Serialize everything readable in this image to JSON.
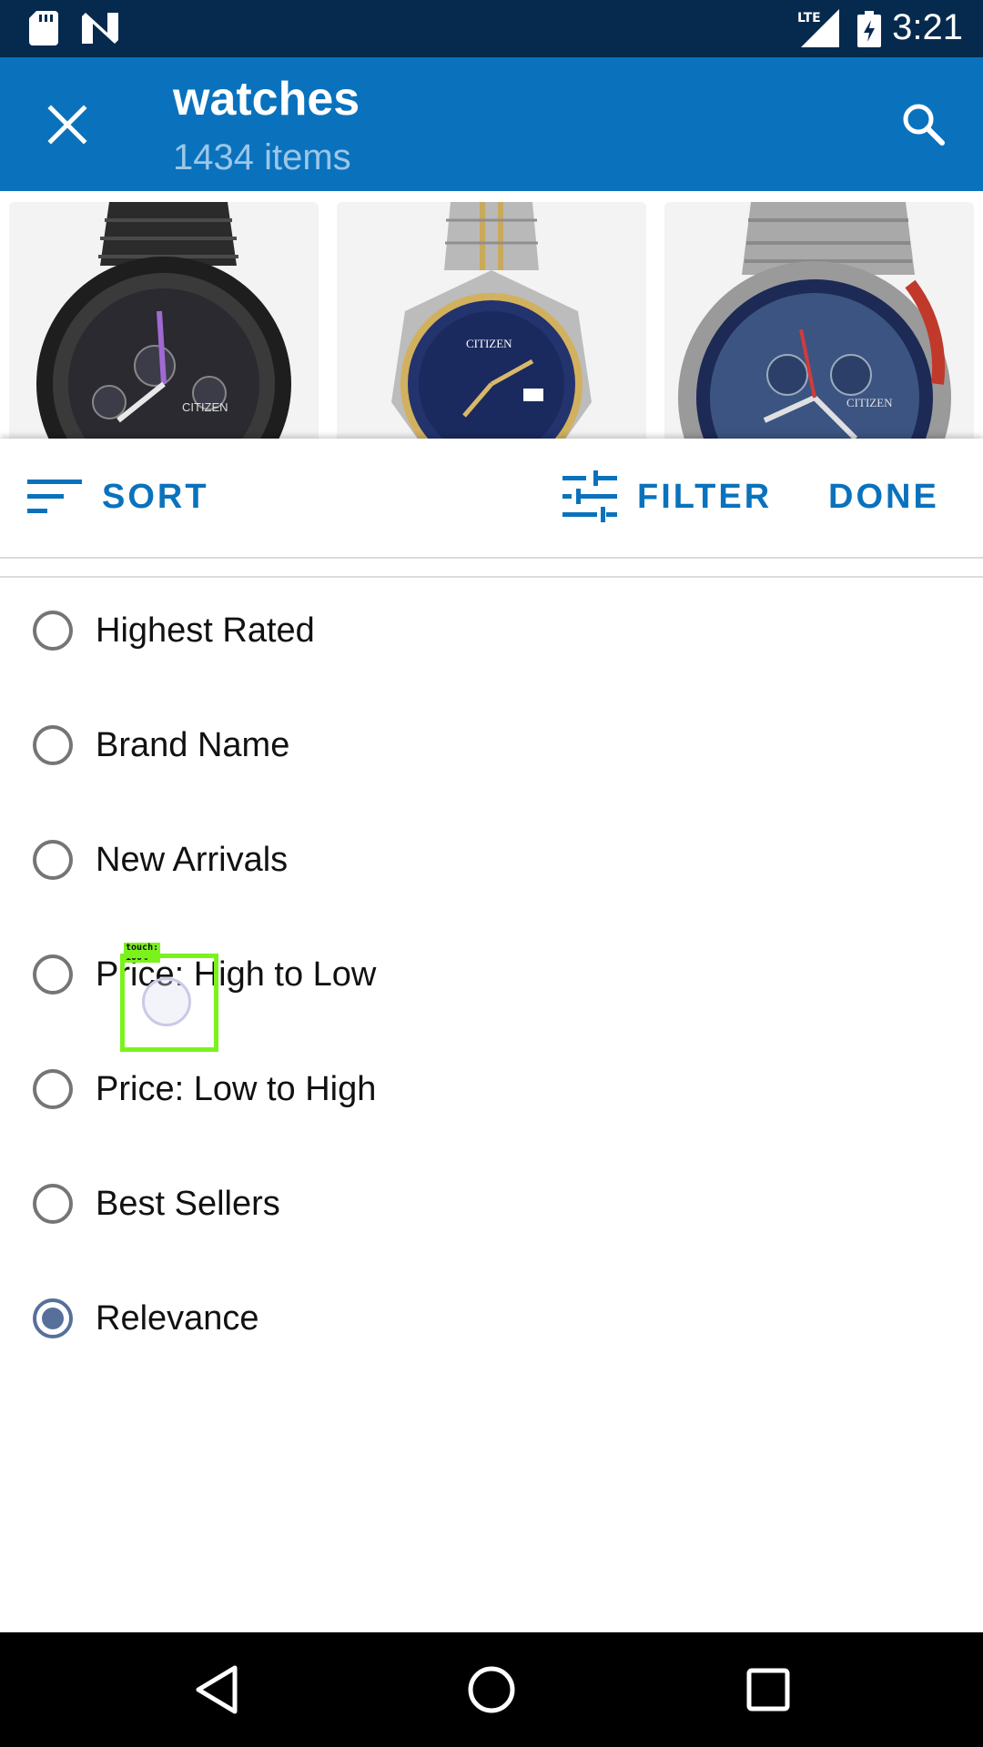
{
  "status_bar": {
    "time": "3:21",
    "network": "LTE",
    "icons": [
      "sd-card-icon",
      "n-notification-icon",
      "lte-signal-icon",
      "battery-charging-icon"
    ]
  },
  "app_bar": {
    "title": "watches",
    "subtitle": "1434 items",
    "close_icon": "close-icon",
    "search_icon": "search-icon",
    "background": "#0a72bd"
  },
  "products": [
    {
      "brand_text": "CITIZEN",
      "style": "black chronograph"
    },
    {
      "brand_text": "CITIZEN",
      "style": "two-tone blue dial"
    },
    {
      "brand_text": "CITIZEN",
      "style": "steel chronograph"
    }
  ],
  "toolbar": {
    "sort_label": "SORT",
    "filter_label": "FILTER",
    "done_label": "DONE",
    "accent": "#0a72bd"
  },
  "sort_options": [
    {
      "label": "Highest Rated",
      "selected": false
    },
    {
      "label": "Brand Name",
      "selected": false
    },
    {
      "label": "New Arrivals",
      "selected": false
    },
    {
      "label": "Price: High to Low",
      "selected": false
    },
    {
      "label": "Price: Low to High",
      "selected": false
    },
    {
      "label": "Best Sellers",
      "selected": false
    },
    {
      "label": "Relevance",
      "selected": true
    }
  ],
  "touch_indicator": {
    "label": "touch: 100%"
  }
}
